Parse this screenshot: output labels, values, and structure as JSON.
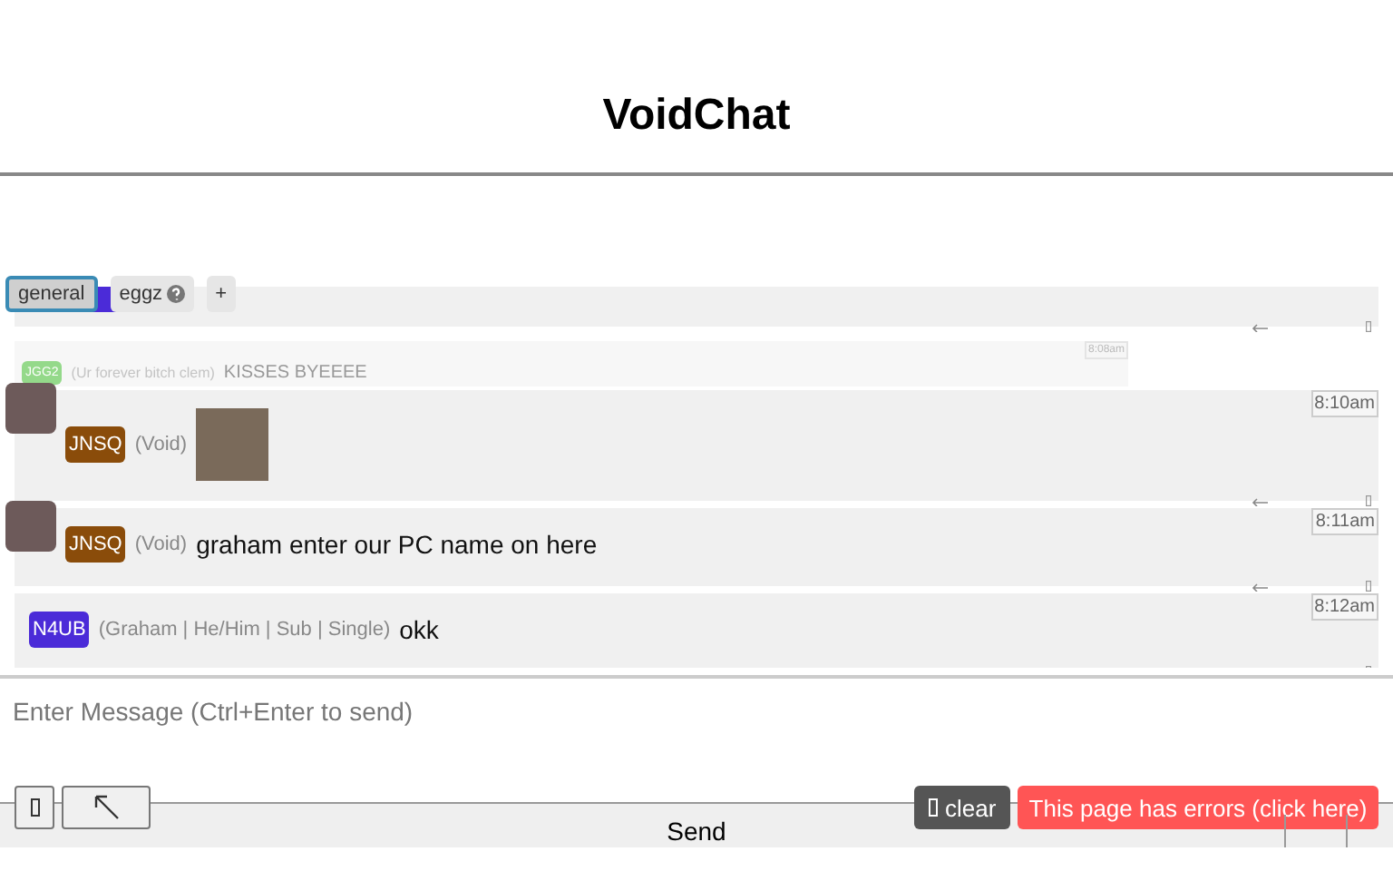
{
  "title": "VoidChat",
  "tabs": [
    {
      "label": "general",
      "selected": true,
      "help": false
    },
    {
      "label": "eggz",
      "selected": false,
      "help": true
    },
    {
      "label": "+",
      "selected": false,
      "help": false
    }
  ],
  "messages": [
    {
      "kind": "cut",
      "color": "#4b2bd8"
    },
    {
      "kind": "faded",
      "badge": "JGG2",
      "color": "#94d98a",
      "tag": "(Ur forever bitch clem)",
      "text": "KISSES BYEEEE",
      "time": "8:08am"
    },
    {
      "kind": "image",
      "avatar": true,
      "badge": "JNSQ",
      "color": "#8a4c0a",
      "tag": "(Void)",
      "time": "8:10am"
    },
    {
      "kind": "text",
      "avatar": true,
      "badge": "JNSQ",
      "color": "#8a4c0a",
      "tag": "(Void)",
      "text": "graham enter our PC name on here",
      "time": "8:11am"
    },
    {
      "kind": "text",
      "avatar": false,
      "badge": "N4UB",
      "color": "#4b2bd8",
      "tag": "(Graham | He/Him | Sub | Single)",
      "text": "okk",
      "time": "8:12am"
    }
  ],
  "composer": {
    "placeholder": "Enter Message (Ctrl+Enter to send)"
  },
  "send": "Send",
  "clear": "clear",
  "error": "This page has errors (click here)"
}
